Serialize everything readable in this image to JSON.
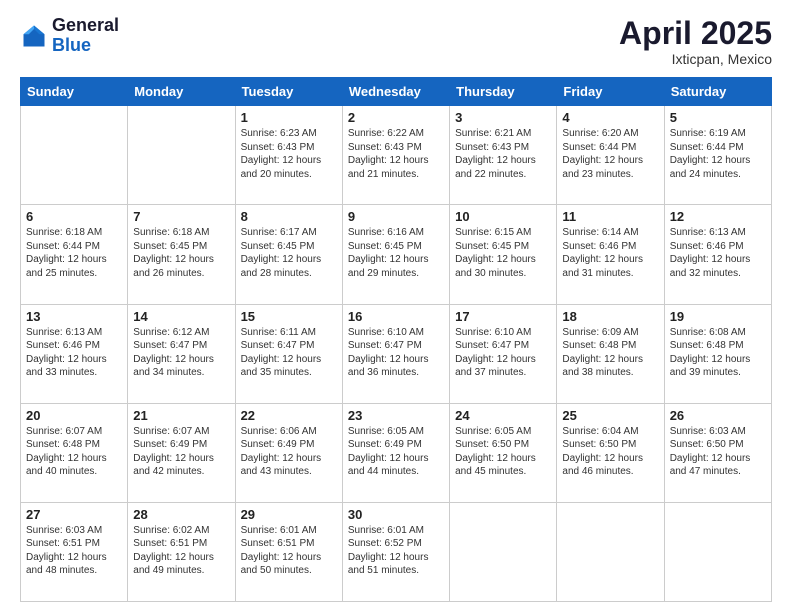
{
  "header": {
    "logo_general": "General",
    "logo_blue": "Blue",
    "month": "April 2025",
    "location": "Ixticpan, Mexico"
  },
  "days_of_week": [
    "Sunday",
    "Monday",
    "Tuesday",
    "Wednesday",
    "Thursday",
    "Friday",
    "Saturday"
  ],
  "weeks": [
    [
      {
        "day": "",
        "info": ""
      },
      {
        "day": "",
        "info": ""
      },
      {
        "day": "1",
        "info": "Sunrise: 6:23 AM\nSunset: 6:43 PM\nDaylight: 12 hours and 20 minutes."
      },
      {
        "day": "2",
        "info": "Sunrise: 6:22 AM\nSunset: 6:43 PM\nDaylight: 12 hours and 21 minutes."
      },
      {
        "day": "3",
        "info": "Sunrise: 6:21 AM\nSunset: 6:43 PM\nDaylight: 12 hours and 22 minutes."
      },
      {
        "day": "4",
        "info": "Sunrise: 6:20 AM\nSunset: 6:44 PM\nDaylight: 12 hours and 23 minutes."
      },
      {
        "day": "5",
        "info": "Sunrise: 6:19 AM\nSunset: 6:44 PM\nDaylight: 12 hours and 24 minutes."
      }
    ],
    [
      {
        "day": "6",
        "info": "Sunrise: 6:18 AM\nSunset: 6:44 PM\nDaylight: 12 hours and 25 minutes."
      },
      {
        "day": "7",
        "info": "Sunrise: 6:18 AM\nSunset: 6:45 PM\nDaylight: 12 hours and 26 minutes."
      },
      {
        "day": "8",
        "info": "Sunrise: 6:17 AM\nSunset: 6:45 PM\nDaylight: 12 hours and 28 minutes."
      },
      {
        "day": "9",
        "info": "Sunrise: 6:16 AM\nSunset: 6:45 PM\nDaylight: 12 hours and 29 minutes."
      },
      {
        "day": "10",
        "info": "Sunrise: 6:15 AM\nSunset: 6:45 PM\nDaylight: 12 hours and 30 minutes."
      },
      {
        "day": "11",
        "info": "Sunrise: 6:14 AM\nSunset: 6:46 PM\nDaylight: 12 hours and 31 minutes."
      },
      {
        "day": "12",
        "info": "Sunrise: 6:13 AM\nSunset: 6:46 PM\nDaylight: 12 hours and 32 minutes."
      }
    ],
    [
      {
        "day": "13",
        "info": "Sunrise: 6:13 AM\nSunset: 6:46 PM\nDaylight: 12 hours and 33 minutes."
      },
      {
        "day": "14",
        "info": "Sunrise: 6:12 AM\nSunset: 6:47 PM\nDaylight: 12 hours and 34 minutes."
      },
      {
        "day": "15",
        "info": "Sunrise: 6:11 AM\nSunset: 6:47 PM\nDaylight: 12 hours and 35 minutes."
      },
      {
        "day": "16",
        "info": "Sunrise: 6:10 AM\nSunset: 6:47 PM\nDaylight: 12 hours and 36 minutes."
      },
      {
        "day": "17",
        "info": "Sunrise: 6:10 AM\nSunset: 6:47 PM\nDaylight: 12 hours and 37 minutes."
      },
      {
        "day": "18",
        "info": "Sunrise: 6:09 AM\nSunset: 6:48 PM\nDaylight: 12 hours and 38 minutes."
      },
      {
        "day": "19",
        "info": "Sunrise: 6:08 AM\nSunset: 6:48 PM\nDaylight: 12 hours and 39 minutes."
      }
    ],
    [
      {
        "day": "20",
        "info": "Sunrise: 6:07 AM\nSunset: 6:48 PM\nDaylight: 12 hours and 40 minutes."
      },
      {
        "day": "21",
        "info": "Sunrise: 6:07 AM\nSunset: 6:49 PM\nDaylight: 12 hours and 42 minutes."
      },
      {
        "day": "22",
        "info": "Sunrise: 6:06 AM\nSunset: 6:49 PM\nDaylight: 12 hours and 43 minutes."
      },
      {
        "day": "23",
        "info": "Sunrise: 6:05 AM\nSunset: 6:49 PM\nDaylight: 12 hours and 44 minutes."
      },
      {
        "day": "24",
        "info": "Sunrise: 6:05 AM\nSunset: 6:50 PM\nDaylight: 12 hours and 45 minutes."
      },
      {
        "day": "25",
        "info": "Sunrise: 6:04 AM\nSunset: 6:50 PM\nDaylight: 12 hours and 46 minutes."
      },
      {
        "day": "26",
        "info": "Sunrise: 6:03 AM\nSunset: 6:50 PM\nDaylight: 12 hours and 47 minutes."
      }
    ],
    [
      {
        "day": "27",
        "info": "Sunrise: 6:03 AM\nSunset: 6:51 PM\nDaylight: 12 hours and 48 minutes."
      },
      {
        "day": "28",
        "info": "Sunrise: 6:02 AM\nSunset: 6:51 PM\nDaylight: 12 hours and 49 minutes."
      },
      {
        "day": "29",
        "info": "Sunrise: 6:01 AM\nSunset: 6:51 PM\nDaylight: 12 hours and 50 minutes."
      },
      {
        "day": "30",
        "info": "Sunrise: 6:01 AM\nSunset: 6:52 PM\nDaylight: 12 hours and 51 minutes."
      },
      {
        "day": "",
        "info": ""
      },
      {
        "day": "",
        "info": ""
      },
      {
        "day": "",
        "info": ""
      }
    ]
  ]
}
